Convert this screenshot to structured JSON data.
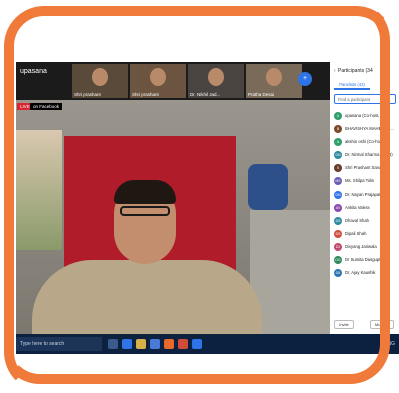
{
  "meeting": {
    "host_name": "upasana",
    "participant_count_badge": "+",
    "live_label": "LIVE",
    "facebook_label": "on Facebook",
    "thumbnails": [
      {
        "label": "Shri prashant"
      },
      {
        "label": "Shri prashant"
      },
      {
        "label": "Dr. Nikhil Jad..."
      },
      {
        "label": "Pratha Desai"
      }
    ]
  },
  "panel": {
    "title": "Participants (34",
    "close_icon": "chevron-left-icon",
    "tab_panelists": "Panelists (42)",
    "tab_attendees": "A",
    "search_placeholder": "Find a participant",
    "participants": [
      {
        "initials": "U",
        "name": "upasana (Co-host, me)",
        "color": "#2e9e6a"
      },
      {
        "initials": "B",
        "name": "BHAVISHYA MAHESHC...",
        "color": "#7a4a2a"
      },
      {
        "initials": "A",
        "name": "akshin oshi (Co-host)",
        "color": "#2e9e6a"
      },
      {
        "initials": "DN",
        "name": "Dr. Nirmal Sharma (IC, B)",
        "color": "#2e8a9e"
      },
      {
        "initials": "S",
        "name": "Shri Prashant Sanda",
        "color": "#6a3a2a"
      },
      {
        "initials": "MS",
        "name": "Ms. Shilpa Tolin",
        "color": "#6a5ab2"
      },
      {
        "initials": "DN",
        "name": "Dr. Nayan Prajapati ...",
        "color": "#2e74e8"
      },
      {
        "initials": "AV",
        "name": "Ankita Valera",
        "color": "#8a4ab2"
      },
      {
        "initials": "DS",
        "name": "Dhaval Shah",
        "color": "#2e8a9e"
      },
      {
        "initials": "DS",
        "name": "Dipali Shah",
        "color": "#d24a3a"
      },
      {
        "initials": "DJ",
        "name": "Divyang Jariwala",
        "color": "#c24a6a"
      },
      {
        "initials": "DG",
        "name": "Dr Sumita Dasgupta",
        "color": "#2e8a5e"
      },
      {
        "initials": "DK",
        "name": "Dr. Ajay Kaushik",
        "color": "#2e74b2"
      }
    ],
    "invite_button": "Invite",
    "mute_all_button": "Mute All"
  },
  "taskbar": {
    "search_text": "Type here to search",
    "tray_text": "^ ENG"
  }
}
